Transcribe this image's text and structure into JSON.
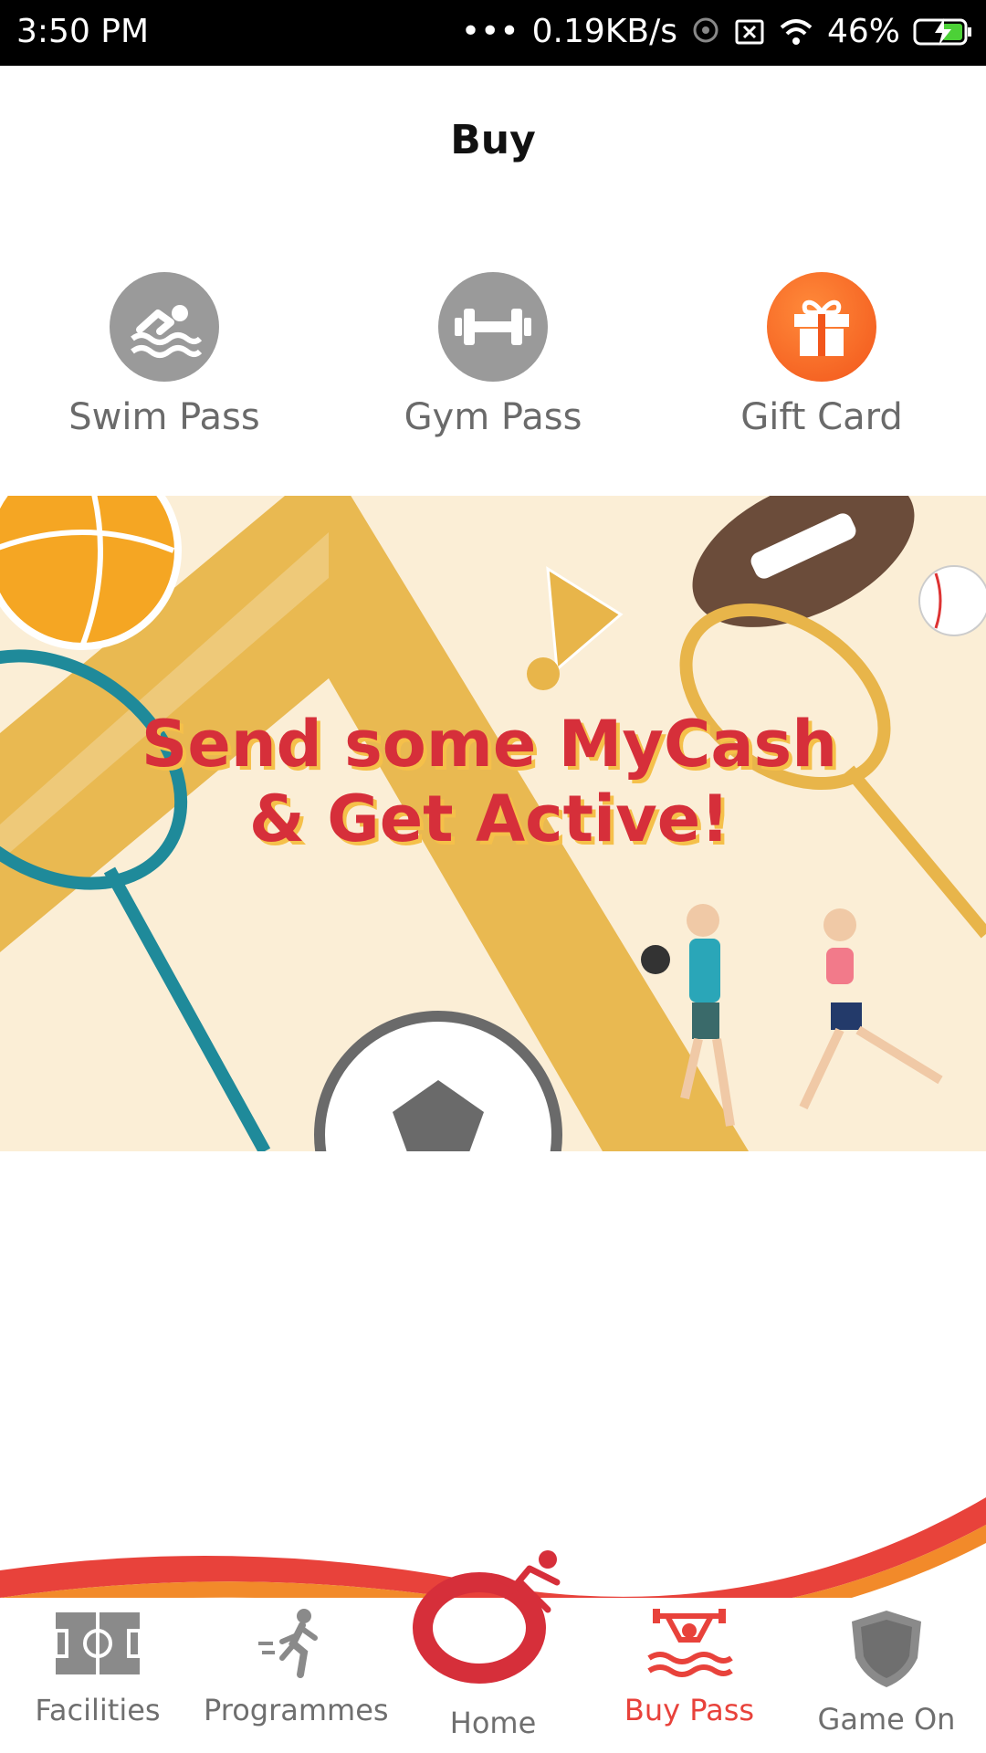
{
  "status_bar": {
    "time": "3:50 PM",
    "network_speed": "0.19KB/s",
    "battery": "46%"
  },
  "header": {
    "title": "Buy"
  },
  "options": [
    {
      "label": "Swim Pass",
      "icon": "swimmer-icon",
      "color": "#9a9a9a"
    },
    {
      "label": "Gym Pass",
      "icon": "dumbbell-icon",
      "color": "#9a9a9a"
    },
    {
      "label": "Gift Card",
      "icon": "gift-icon",
      "color": "#f26b1d"
    }
  ],
  "banner": {
    "line1": "Send some MyCash",
    "line2": "& Get Active!"
  },
  "nav": {
    "facilities": "Facilities",
    "programmes": "Programmes",
    "home": "Home",
    "buy_pass": "Buy Pass",
    "game_on": "Game On",
    "active_color": "#e8423b"
  }
}
